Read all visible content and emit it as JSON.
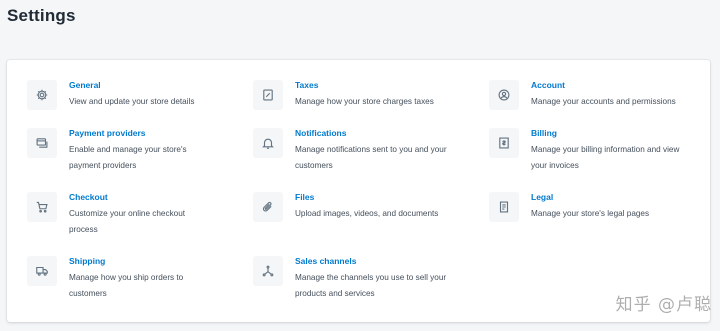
{
  "page": {
    "title": "Settings"
  },
  "settings": [
    {
      "title": "General",
      "desc": "View and update your store details",
      "icon": "gear-icon"
    },
    {
      "title": "Taxes",
      "desc": "Manage how your store charges taxes",
      "icon": "receipt-icon"
    },
    {
      "title": "Account",
      "desc": "Manage your accounts and permissions",
      "icon": "profile-icon"
    },
    {
      "title": "Payment providers",
      "desc": "Enable and manage your store's payment providers",
      "icon": "payment-icon"
    },
    {
      "title": "Notifications",
      "desc": "Manage notifications sent to you and your customers",
      "icon": "bell-icon"
    },
    {
      "title": "Billing",
      "desc": "Manage your billing information and view your invoices",
      "icon": "invoice-icon"
    },
    {
      "title": "Checkout",
      "desc": "Customize your online checkout process",
      "icon": "cart-icon"
    },
    {
      "title": "Files",
      "desc": "Upload images, videos, and documents",
      "icon": "paperclip-icon"
    },
    {
      "title": "Legal",
      "desc": "Manage your store's legal pages",
      "icon": "document-icon"
    },
    {
      "title": "Shipping",
      "desc": "Manage how you ship orders to customers",
      "icon": "truck-icon"
    },
    {
      "title": "Sales channels",
      "desc": "Manage the channels you use to sell your products and services",
      "icon": "channels-icon"
    }
  ],
  "watermark": "知乎 @卢聪",
  "colors": {
    "link": "#007ace",
    "text": "#212b36",
    "subdued": "#454f5b",
    "icon": "#637381",
    "background": "#f4f6f8"
  }
}
